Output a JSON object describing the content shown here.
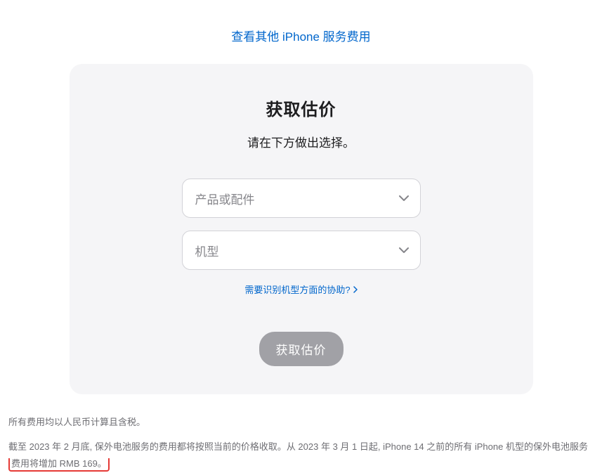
{
  "header": {
    "link": "查看其他 iPhone 服务费用"
  },
  "card": {
    "title": "获取估价",
    "subtitle": "请在下方做出选择。",
    "select1_placeholder": "产品或配件",
    "select2_placeholder": "机型",
    "help_link": "需要识别机型方面的协助?",
    "submit": "获取估价"
  },
  "footer": {
    "line1": "所有费用均以人民币计算且含税。",
    "line2_prefix": "截至 2023 年 2 月底, 保外电池服务的费用都将按照当前的价格收取。从 2023 年 3 月 1 日起, iPhone 14 之前的所有 iPhone 机型的保外电池服务",
    "line2_highlight": "费用将增加 RMB 169。"
  }
}
